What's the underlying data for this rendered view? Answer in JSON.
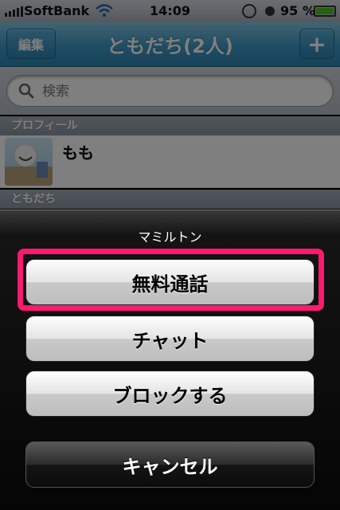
{
  "status": {
    "carrier": "SoftBank",
    "time": "14:09",
    "battery": "95 %"
  },
  "nav": {
    "edit_label": "編集",
    "title": "ともだち(2人)",
    "add_label": "+"
  },
  "search": {
    "placeholder": "検索"
  },
  "list": {
    "section_profile": "プロフィール",
    "profile_name": "もも",
    "section_friends": "ともだち"
  },
  "action_sheet": {
    "title": "マミルトン",
    "buttons": [
      "無料通話",
      "チャット",
      "ブロックする"
    ],
    "cancel": "キャンセル",
    "highlight_color": "#fb1a6d"
  },
  "colors": {
    "nav_accent": "#3f9ac6",
    "battery_fill": "#4cc21f"
  }
}
